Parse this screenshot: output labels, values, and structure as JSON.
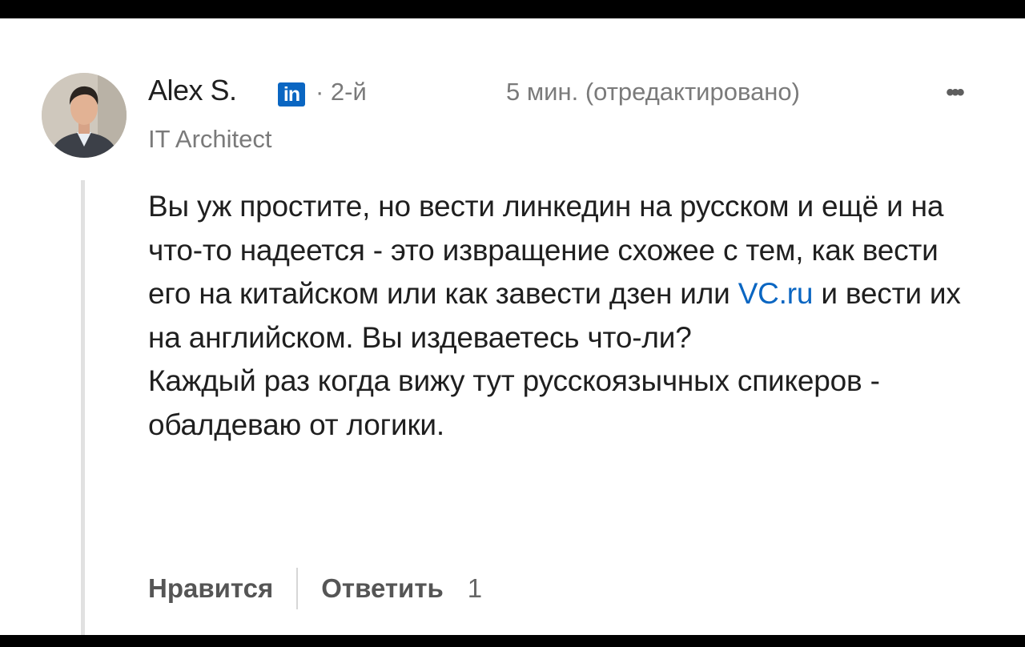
{
  "comment": {
    "author": {
      "name": "Alex S.",
      "badge_icon": "linkedin-icon",
      "badge_text": "in",
      "connection_degree": "· 2-й",
      "headline": "IT Architect"
    },
    "timestamp": "5 мин. (отредактировано)",
    "more_icon": "ellipsis-icon",
    "more_label": "•••",
    "body": {
      "para1_start": "Вы уж простите, но вести линкедин на русском и ещё и на что-то надеется - это извращение схожее с тем, как вести его на китайском или как завести дзен или ",
      "para1_link": "VC.ru",
      "para1_end": " и вести их на английском. Вы издеваетесь что-ли?",
      "para2": "Каждый раз когда вижу тут русскоязычных спикеров - обалдеваю от логики."
    },
    "actions": {
      "like_label": "Нравится",
      "reply_label": "Ответить",
      "reply_count": "1"
    }
  },
  "colors": {
    "link": "#0a66c2",
    "text": "#1f1f1f",
    "muted": "#7a7a7a",
    "background": "#ffffff",
    "frame": "#000000"
  }
}
